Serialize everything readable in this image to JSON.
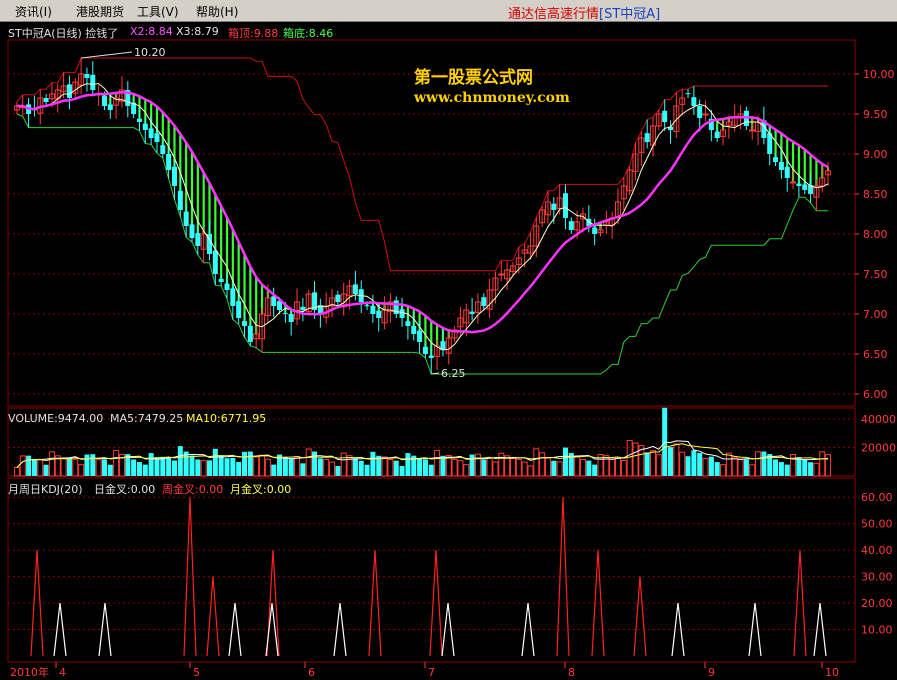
{
  "menu": {
    "items": [
      "资讯(I)",
      "港股期货",
      "工具(V)",
      "帮助(H)"
    ],
    "title": "通达信高速行情",
    "stock_tag": "[ST中冠A]"
  },
  "main_panel": {
    "label": "ST中冠A(日线) 捡钱了",
    "x2": "X2:8.84",
    "x3": "X3:8.79",
    "box_top": "箱顶:9.88",
    "box_bottom": "箱底:8.46",
    "high_mark": "10.20",
    "low_mark": "6.25",
    "watermark_line1": "第一股票公式网",
    "watermark_line2": "www.chnmoney.com"
  },
  "volume_panel": {
    "volume": "VOLUME:9474.00",
    "ma5": "MA5:7479.25",
    "ma10": "MA10:6771.95"
  },
  "kdj_panel": {
    "label": "月周日KDJ(20)",
    "daily": "日金叉:0.00",
    "weekly": "周金叉:0.00",
    "monthly": "月金叉:0.00"
  },
  "colors": {
    "up": "#ff3a3a",
    "down": "#33ffff",
    "ma_long": "#ff33ff",
    "box_band_upper": "#cc1010",
    "box_band_lower": "#2fcf2f",
    "fill": "#33ff33",
    "grid": "#8b0000"
  },
  "chart_data": [
    {
      "type": "candlestick",
      "title": "ST中冠A(日线)",
      "y_ticks": [
        "10.00",
        "9.50",
        "9.00",
        "8.50",
        "8.00",
        "7.50",
        "7.00",
        "6.50",
        "6.00"
      ],
      "ylim": [
        6.0,
        10.2
      ],
      "x_labels": [
        "2010年",
        "4",
        "5",
        "6",
        "7",
        "8",
        "9",
        "10"
      ],
      "high": 10.2,
      "low": 6.25,
      "close_series": [
        9.6,
        9.6,
        9.5,
        9.55,
        9.7,
        9.65,
        9.75,
        9.8,
        9.85,
        9.7,
        9.9,
        10.0,
        9.95,
        9.8,
        9.75,
        9.6,
        9.55,
        9.7,
        9.8,
        9.6,
        9.5,
        9.4,
        9.3,
        9.2,
        9.15,
        9.0,
        8.8,
        8.6,
        8.3,
        8.1,
        7.95,
        7.85,
        8.0,
        7.75,
        7.5,
        7.4,
        7.3,
        7.1,
        6.95,
        6.85,
        6.65,
        6.75,
        7.0,
        7.2,
        7.1,
        7.05,
        7.0,
        6.9,
        7.15,
        7.05,
        7.25,
        7.05,
        7.0,
        7.1,
        7.2,
        7.15,
        7.25,
        7.35,
        7.25,
        7.15,
        7.1,
        7.0,
        6.95,
        7.05,
        7.15,
        7.0,
        6.95,
        6.85,
        6.75,
        6.65,
        6.5,
        6.45,
        6.6,
        6.55,
        6.7,
        6.8,
        6.95,
        7.05,
        7.0,
        7.15,
        7.1,
        7.3,
        7.45,
        7.5,
        7.55,
        7.6,
        7.7,
        7.8,
        7.85,
        8.1,
        8.3,
        8.4,
        8.3,
        8.45,
        8.2,
        8.05,
        8.15,
        8.25,
        8.1,
        8.0,
        8.05,
        8.15,
        8.2,
        8.4,
        8.6,
        8.8,
        9.0,
        9.2,
        9.15,
        9.35,
        9.5,
        9.4,
        9.3,
        9.6,
        9.7,
        9.75,
        9.6,
        9.45,
        9.5,
        9.3,
        9.2,
        9.3,
        9.4,
        9.45,
        9.5,
        9.35,
        9.3,
        9.4,
        9.2,
        9.0,
        8.9,
        8.8,
        8.7,
        8.65,
        8.6,
        8.55,
        8.5,
        8.6,
        8.7,
        8.79
      ]
    },
    {
      "type": "bar",
      "title": "VOLUME",
      "y_ticks": [
        "40000",
        "20000"
      ],
      "ylim": [
        0,
        45000
      ]
    },
    {
      "type": "line",
      "title": "月周日KDJ(20)",
      "y_ticks": [
        "60.00",
        "50.00",
        "40.00",
        "30.00",
        "20.00",
        "10.00"
      ],
      "ylim": [
        0,
        65
      ],
      "red_spikes": [
        [
          37,
          40
        ],
        [
          190,
          60
        ],
        [
          213,
          30
        ],
        [
          273,
          40
        ],
        [
          375,
          40
        ],
        [
          436,
          40
        ],
        [
          563,
          60
        ],
        [
          598,
          40
        ],
        [
          640,
          30
        ],
        [
          800,
          40
        ]
      ],
      "white_spikes": [
        [
          60,
          20
        ],
        [
          105,
          20
        ],
        [
          235,
          20
        ],
        [
          272,
          20
        ],
        [
          340,
          20
        ],
        [
          448,
          20
        ],
        [
          528,
          20
        ],
        [
          678,
          20
        ],
        [
          755,
          20
        ],
        [
          820,
          20
        ]
      ]
    }
  ]
}
